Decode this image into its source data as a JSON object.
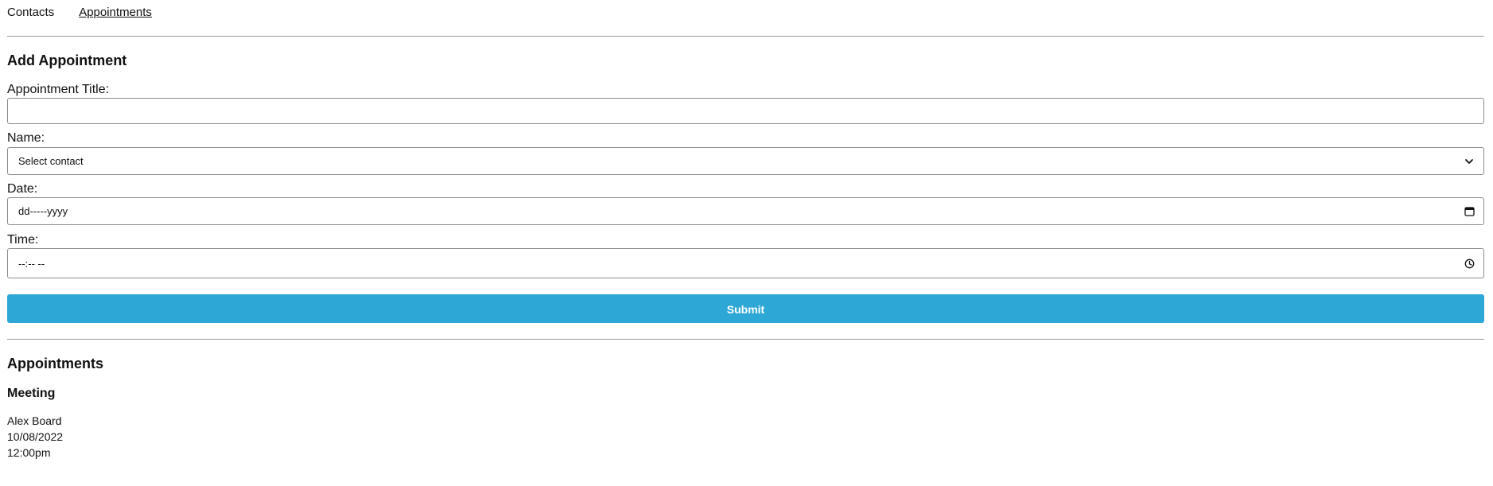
{
  "nav": {
    "contacts_label": "Contacts",
    "appointments_label": "Appointments"
  },
  "add_section": {
    "heading": "Add Appointment",
    "title_label": "Appointment Title:",
    "title_value": "",
    "name_label": "Name:",
    "name_selected": "Select contact",
    "date_label": "Date:",
    "date_placeholder": "dd-----yyyy",
    "time_label": "Time:",
    "time_placeholder": "--:-- --",
    "submit_label": "Submit"
  },
  "appointments_section": {
    "heading": "Appointments",
    "items": [
      {
        "title": "Meeting",
        "contact": "Alex Board",
        "date": "10/08/2022",
        "time": "12:00pm"
      }
    ]
  },
  "colors": {
    "accent": "#2da7d6",
    "divider": "#9a9a9a",
    "text": "#111111"
  },
  "icons": {
    "select": "chevron-down-icon",
    "date": "calendar-icon",
    "time": "clock-icon"
  }
}
